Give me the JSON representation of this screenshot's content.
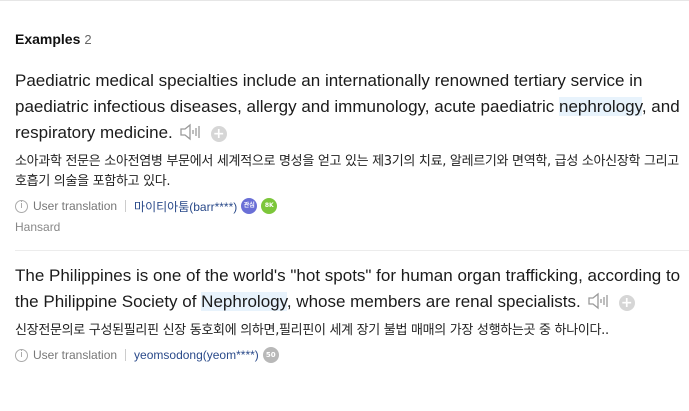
{
  "header": {
    "title": "Examples",
    "count": "2"
  },
  "examples": [
    {
      "en_before": "Paediatric medical specialties include an internationally renowned tertiary service in paediatric infectious diseases, allergy and immunology, acute paediatric ",
      "en_highlight": "nephrology",
      "en_after": ", and respiratory medicine.",
      "ko": "소아과학 전문은 소아전염병 부문에서 세계적으로 명성을 얻고 있는 제3기의 치료, 알레르기와 면역학, 급성 소아신장학 그리고 호흡기 의술을 포함하고 있다.",
      "translation_label": "User translation",
      "user": "마이티아툼(barr****)",
      "badges": [
        {
          "text": "관심",
          "color": "#6a6fd6"
        },
        {
          "text": "8K",
          "color": "#7cc63a"
        }
      ],
      "source": "Hansard"
    },
    {
      "en_before": "The Philippines is one of the world's \"hot spots\" for human organ trafficking, according to the Philippine Society of ",
      "en_highlight": "Nephrology",
      "en_after": ", whose members are renal specialists.",
      "ko": "신장전문의로 구성된필리핀 신장 동호회에 의하면,필리핀이 세계 장기 불법 매매의 가장 성행하는곳 중 하나이다..",
      "translation_label": "User translation",
      "user": "yeomsodong(yeom****)",
      "badges": [
        {
          "text": "50",
          "color": "#b8b8b8"
        }
      ]
    }
  ],
  "icons": {
    "audio": "speaker-icon",
    "add": "plus-icon",
    "info": "info-icon"
  },
  "glyphs": {
    "plus": "+",
    "info": "i"
  }
}
